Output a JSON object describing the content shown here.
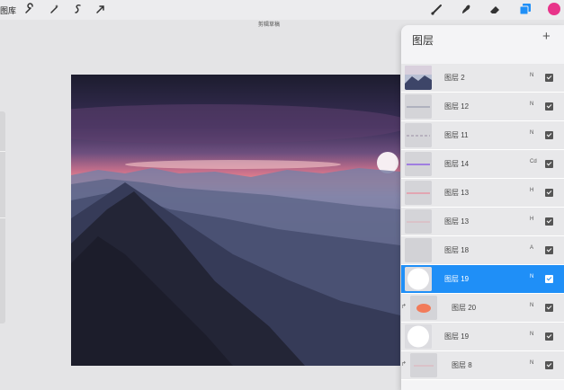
{
  "toolbar": {
    "gallery_label": "图库",
    "left_tools": [
      "wrench-icon",
      "magic-wand-icon",
      "selection-icon",
      "transform-icon"
    ],
    "right_tools": [
      "brush-icon",
      "smudge-icon",
      "eraser-icon",
      "layers-icon"
    ],
    "color": "#e8348a",
    "active_tool_color": "#1f8ff7"
  },
  "document": {
    "title": "剪辑草稿"
  },
  "layers_panel": {
    "title": "图层",
    "add_label": "+",
    "layers": [
      {
        "name": "图层 2",
        "mode": "N",
        "visible": true,
        "selected": false,
        "thumb": "mountain"
      },
      {
        "name": "图层 12",
        "mode": "N",
        "visible": true,
        "selected": false,
        "thumb": "line-gray"
      },
      {
        "name": "图层 11",
        "mode": "N",
        "visible": true,
        "selected": false,
        "thumb": "line-dash"
      },
      {
        "name": "图层 14",
        "mode": "Cd",
        "visible": true,
        "selected": false,
        "thumb": "line-purple"
      },
      {
        "name": "图层 13",
        "mode": "H",
        "visible": true,
        "selected": false,
        "thumb": "line-pink"
      },
      {
        "name": "图层 13",
        "mode": "H",
        "visible": true,
        "selected": false,
        "thumb": "line-faint"
      },
      {
        "name": "图层 18",
        "mode": "A",
        "visible": true,
        "selected": false,
        "thumb": "blank"
      },
      {
        "name": "图层 19",
        "mode": "N",
        "visible": true,
        "selected": true,
        "thumb": "circle"
      },
      {
        "name": "图层 20",
        "mode": "N",
        "visible": true,
        "selected": false,
        "thumb": "orange"
      },
      {
        "name": "图层 19",
        "mode": "N",
        "visible": true,
        "selected": false,
        "thumb": "circle"
      },
      {
        "name": "图层 8",
        "mode": "N",
        "visible": true,
        "selected": false,
        "thumb": "line-faint"
      }
    ]
  }
}
